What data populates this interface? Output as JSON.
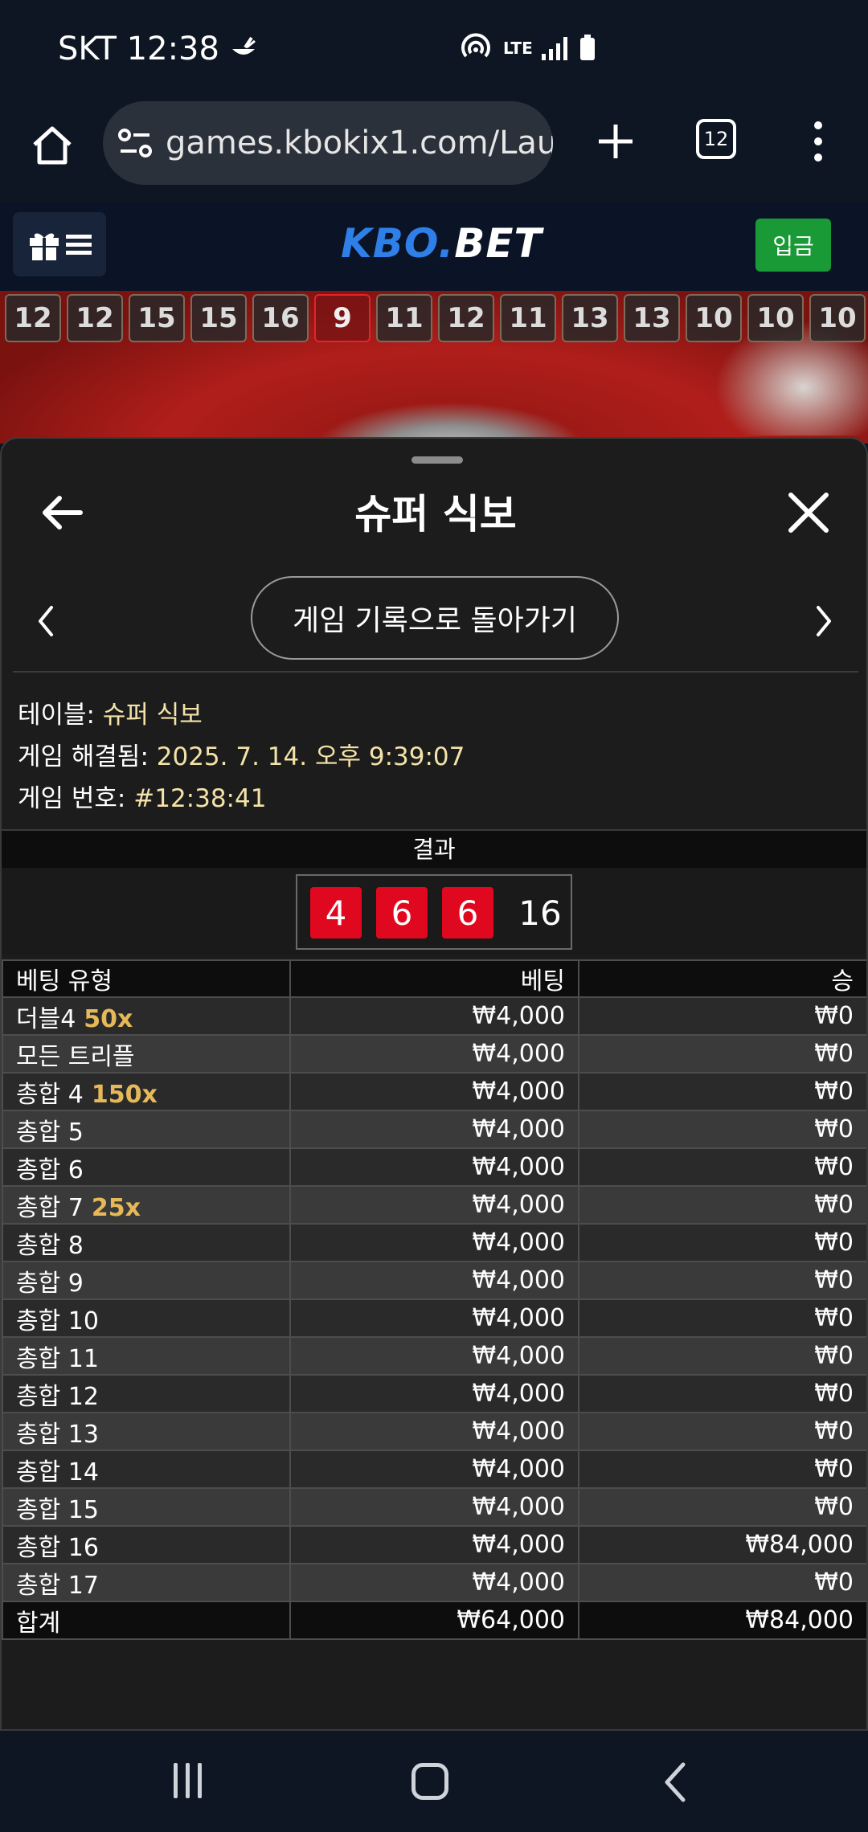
{
  "status_bar": {
    "carrier_time": "SKT 12:38",
    "network": "LTE"
  },
  "browser": {
    "url": "games.kbokix1.com/Laun",
    "tab_count": "12"
  },
  "site": {
    "logo_part1": "KBO.",
    "logo_part2": "BET",
    "deposit_label": "입금"
  },
  "history_numbers": [
    "12",
    "12",
    "15",
    "15",
    "16",
    "9",
    "11",
    "12",
    "11",
    "13",
    "13",
    "10",
    "10",
    "10"
  ],
  "panel": {
    "title": "슈퍼 식보",
    "back_to_history": "게임 기록으로 돌아가기",
    "table_label": "테이블:",
    "table_value": "슈퍼 식보",
    "resolved_label": "게임 해결됨:",
    "resolved_value": "2025. 7. 14. 오후 9:39:07",
    "game_no_label": "게임 번호:",
    "game_no_value": "#12:38:41",
    "result_header": "결과",
    "dice": [
      "4",
      "6",
      "6"
    ],
    "total": "16"
  },
  "bets_table": {
    "headers": [
      "베팅 유형",
      "베팅",
      "승"
    ],
    "rows": [
      {
        "type": "더블4",
        "payout": "50x",
        "bet": "₩4,000",
        "win": "₩0"
      },
      {
        "type": "모든 트리플",
        "payout": "",
        "bet": "₩4,000",
        "win": "₩0"
      },
      {
        "type": "총합 4",
        "payout": "150x",
        "bet": "₩4,000",
        "win": "₩0"
      },
      {
        "type": "총합 5",
        "payout": "",
        "bet": "₩4,000",
        "win": "₩0"
      },
      {
        "type": "총합 6",
        "payout": "",
        "bet": "₩4,000",
        "win": "₩0"
      },
      {
        "type": "총합 7",
        "payout": "25x",
        "bet": "₩4,000",
        "win": "₩0"
      },
      {
        "type": "총합 8",
        "payout": "",
        "bet": "₩4,000",
        "win": "₩0"
      },
      {
        "type": "총합 9",
        "payout": "",
        "bet": "₩4,000",
        "win": "₩0"
      },
      {
        "type": "총합 10",
        "payout": "",
        "bet": "₩4,000",
        "win": "₩0"
      },
      {
        "type": "총합 11",
        "payout": "",
        "bet": "₩4,000",
        "win": "₩0"
      },
      {
        "type": "총합 12",
        "payout": "",
        "bet": "₩4,000",
        "win": "₩0"
      },
      {
        "type": "총합 13",
        "payout": "",
        "bet": "₩4,000",
        "win": "₩0"
      },
      {
        "type": "총합 14",
        "payout": "",
        "bet": "₩4,000",
        "win": "₩0"
      },
      {
        "type": "총합 15",
        "payout": "",
        "bet": "₩4,000",
        "win": "₩0"
      },
      {
        "type": "총합 16",
        "payout": "",
        "bet": "₩4,000",
        "win": "₩84,000"
      },
      {
        "type": "총합 17",
        "payout": "",
        "bet": "₩4,000",
        "win": "₩0"
      }
    ],
    "total_row": {
      "type": "합계",
      "bet": "₩64,000",
      "win": "₩84,000"
    }
  },
  "colors": {
    "accent_gold": "#e5b95a",
    "die_red": "#e0081e",
    "deposit_green": "#1a9a36",
    "logo_blue": "#2f7fe8"
  }
}
